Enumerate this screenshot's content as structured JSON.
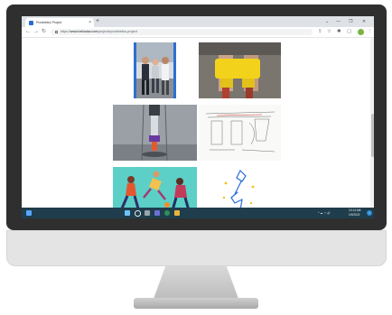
{
  "browser": {
    "tab_title": "Prosthetics Project",
    "tab_close": "×",
    "new_tab": "+",
    "window_controls": [
      "⌄",
      "—",
      "❐",
      "✕"
    ],
    "nav": {
      "back": "←",
      "forward": "→",
      "reload": "↻"
    },
    "url_scheme": "https://",
    "url_host": "www.hellostav.com",
    "url_path": "/projects/prosthetics-project",
    "toolbar_icons": [
      "share-icon",
      "star-icon",
      "extensions-icon",
      "sidebar-icon",
      "profile-avatar",
      "menu-icon"
    ]
  },
  "page": {
    "images": [
      {
        "name": "team-photo",
        "alt": "team of people standing in a lab"
      },
      {
        "name": "yellow-socket-photo",
        "alt": "prosthetic leg wrapped in yellow tape"
      },
      {
        "name": "pylon-prototype-photo",
        "alt": "tall prosthetic pylon prototype"
      },
      {
        "name": "design-sketch",
        "alt": "hand-drawn design sketch"
      },
      {
        "name": "athletes-illustration",
        "alt": "illustration of runners and athletes"
      },
      {
        "name": "prosthetic-line-drawing",
        "alt": "blue line drawing of a prosthetic leg"
      }
    ]
  },
  "taskbar": {
    "time": "10:14 AM",
    "date": "1/9/2022",
    "tray_icons": "^  ☁  ⌔  🔊",
    "notification_count": "2"
  },
  "colors": {
    "monitor_bezel": "#2f2f2f",
    "taskbar": "#1f3d4c",
    "accent_blue": "#2a6bd6",
    "tape_yellow": "#f3d21b",
    "illustration_teal": "#5ccfc7"
  }
}
